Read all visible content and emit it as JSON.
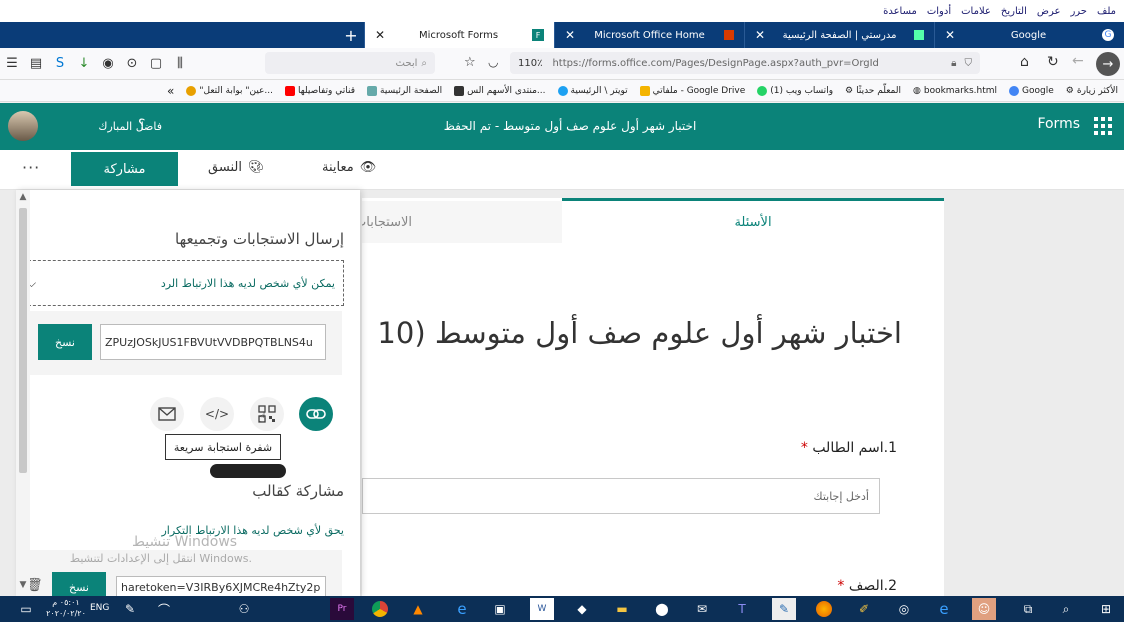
{
  "browser": {
    "menu": [
      "ملف",
      "حرر",
      "عرض",
      "التاريخ",
      "علامات",
      "أدوات",
      "مساعدة"
    ],
    "tabs": [
      {
        "label": "Google",
        "icon": "google-icon"
      },
      {
        "label": "مدرستي | الصفحة الرئيسية",
        "icon": "school-icon"
      },
      {
        "label": "Microsoft Office Home",
        "icon": "office-icon"
      },
      {
        "label": "Microsoft Forms",
        "icon": "forms-icon",
        "active": true
      }
    ],
    "new_tab": "+",
    "close": "✕",
    "zoom": "110٪",
    "url": "https://forms.office.com/Pages/DesignPage.aspx?auth_pvr=OrgId",
    "search_placeholder": "ابحث",
    "bookmarks": [
      "الأكثر زيارة",
      "Google",
      "bookmarks.html",
      "المعلّم حديثًا",
      "(1) واتساب ويب",
      "ملفاتي - Google Drive",
      "تويتر \\ الرئيسية",
      "منتدى الأسهم الس...",
      "الصفحة الرئيسية",
      "قناتي وتفاصيلها",
      "\"عين\" بوابة التعل..."
    ]
  },
  "forms": {
    "brand": "Forms",
    "title": "اختبار شهر أول علوم صف أول متوسط - تم الحفظ",
    "user_name": "فاضل المبارك",
    "help": "؟"
  },
  "toolbar": {
    "share": "مشاركة",
    "theme": "النسق",
    "preview": "معاينة",
    "more": "···"
  },
  "share_panel": {
    "send_title": "إرسال الاستجابات وتجميعها",
    "link_option": "يمكن لأي شخص لديه هذا الارتباط الرد",
    "link_value": "ZPUzJOSkJUS1FBVUtVVDBPQTBLNS4u",
    "copy": "نسخ",
    "tooltip": "شفرة استجابة سريعة",
    "collab_title": "مشاركة كقالب",
    "collab_desc": "يحق لأي شخص لديه هذا الارتباط التكرار",
    "collab_value": "haretoken=V3IRBy6XJMCRe4hZty2p",
    "collab_copy": "نسخ"
  },
  "form": {
    "tab_questions": "الأسئلة",
    "tab_responses": "الاستجابات",
    "quiz_title": "اختبار شهر أول علوم صف أول متوسط (10",
    "q1_label": "1.اسم الطالب",
    "q1_placeholder": "أدخل إجابتك",
    "q2_label": "2.الصف",
    "required": "*"
  },
  "watermark": {
    "line1": "تنشيط Windows",
    "line2": "انتقل إلى الإعدادات لتنشيط Windows."
  },
  "taskbar": {
    "time": "٠٥:٠١ م",
    "date": "٢٠٢٠/٠٢/٢٠",
    "lang": "ENG"
  },
  "colors": {
    "forms_teal": "#0b8379",
    "browser_tabbar": "#0a3c78",
    "taskbar": "#0c2f56"
  }
}
